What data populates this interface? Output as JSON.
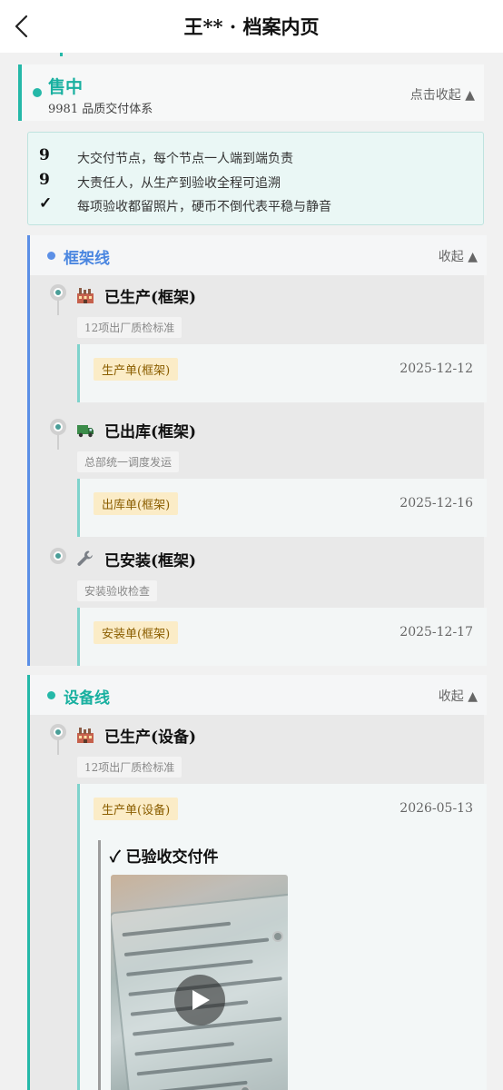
{
  "header": {
    "title": "王** · 档案内页"
  },
  "stage": {
    "title": "售中",
    "subtitle": "9981 品质交付体系",
    "toggle": "点击收起 ▲",
    "accent": "#25b8a8"
  },
  "summary": [
    {
      "value": "9",
      "text": "大交付节点，每个节点一人端到端负责"
    },
    {
      "value": "9",
      "text": "大责任人，从生产到验收全程可追溯"
    },
    {
      "value": "✓",
      "text": "每项验收都留照片，硬币不倒代表平稳与静音"
    }
  ],
  "lines": [
    {
      "title": "框架线",
      "toggle": "收起 ▲",
      "color": "#5b8fe6",
      "steps": [
        {
          "icon": "factory-icon",
          "title": "已生产(框架)",
          "note": "12项出厂质检标准",
          "doc": "生产单(框架)",
          "date": "2025-12-12"
        },
        {
          "icon": "truck-icon",
          "title": "已出库(框架)",
          "note": "总部统一调度发运",
          "doc": "出库单(框架)",
          "date": "2025-12-16"
        },
        {
          "icon": "wrench-icon",
          "title": "已安装(框架)",
          "note": "安装验收检查",
          "doc": "安装单(框架)",
          "date": "2025-12-17"
        }
      ]
    },
    {
      "title": "设备线",
      "toggle": "收起 ▲",
      "color": "#25b8a8",
      "steps": [
        {
          "icon": "factory-icon",
          "title": "已生产(设备)",
          "note": "12项出厂质检标准",
          "doc": "生产单(设备)",
          "date": "2026-05-13",
          "evidence": "✓ 已验收交付件"
        }
      ]
    }
  ]
}
